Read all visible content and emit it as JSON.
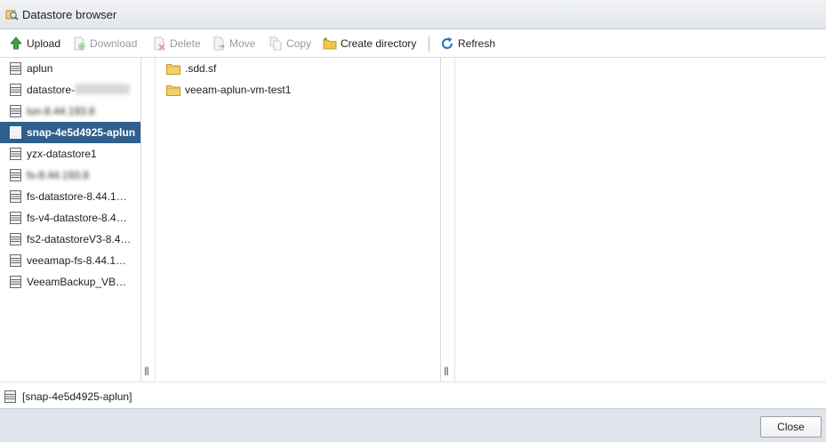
{
  "window": {
    "title": "Datastore browser",
    "icon": "datastore-browser-icon"
  },
  "toolbar": {
    "upload": {
      "label": "Upload",
      "icon": "upload-icon",
      "enabled": true
    },
    "download": {
      "label": "Download",
      "icon": "download-icon",
      "enabled": false
    },
    "delete": {
      "label": "Delete",
      "icon": "delete-icon",
      "enabled": false
    },
    "move": {
      "label": "Move",
      "icon": "move-icon",
      "enabled": false
    },
    "copy": {
      "label": "Copy",
      "icon": "copy-icon",
      "enabled": false
    },
    "create_directory": {
      "label": "Create directory",
      "icon": "new-folder-icon",
      "enabled": true
    },
    "refresh": {
      "label": "Refresh",
      "icon": "refresh-icon",
      "enabled": true
    }
  },
  "datastores": [
    {
      "label": "aplun",
      "selected": false
    },
    {
      "label": "datastore-",
      "selected": false,
      "redacted": true
    },
    {
      "label": "lun-8.44.193.8",
      "selected": false,
      "redacted": true
    },
    {
      "label": "snap-4e5d4925-aplun",
      "selected": true
    },
    {
      "label": "yzx-datastore1",
      "selected": false
    },
    {
      "label": "fs-8.44.193.8",
      "selected": false,
      "redacted": true
    },
    {
      "label": "fs-datastore-8.44.1…",
      "selected": false
    },
    {
      "label": "fs-v4-datastore-8.4…",
      "selected": false
    },
    {
      "label": "fs2-datastoreV3-8.4…",
      "selected": false
    },
    {
      "label": "veeamap-fs-8.44.1…",
      "selected": false
    },
    {
      "label": "VeeamBackup_VB…",
      "selected": false
    }
  ],
  "folders": [
    {
      "label": ".sdd.sf"
    },
    {
      "label": "veeam-aplun-vm-test1"
    }
  ],
  "status": {
    "path": "[snap-4e5d4925-aplun]"
  },
  "footer": {
    "close_label": "Close"
  },
  "colors": {
    "selection": "#2f5f8c",
    "footer_bg": "#dfe4ea",
    "disabled_text": "#9a9a9a"
  }
}
